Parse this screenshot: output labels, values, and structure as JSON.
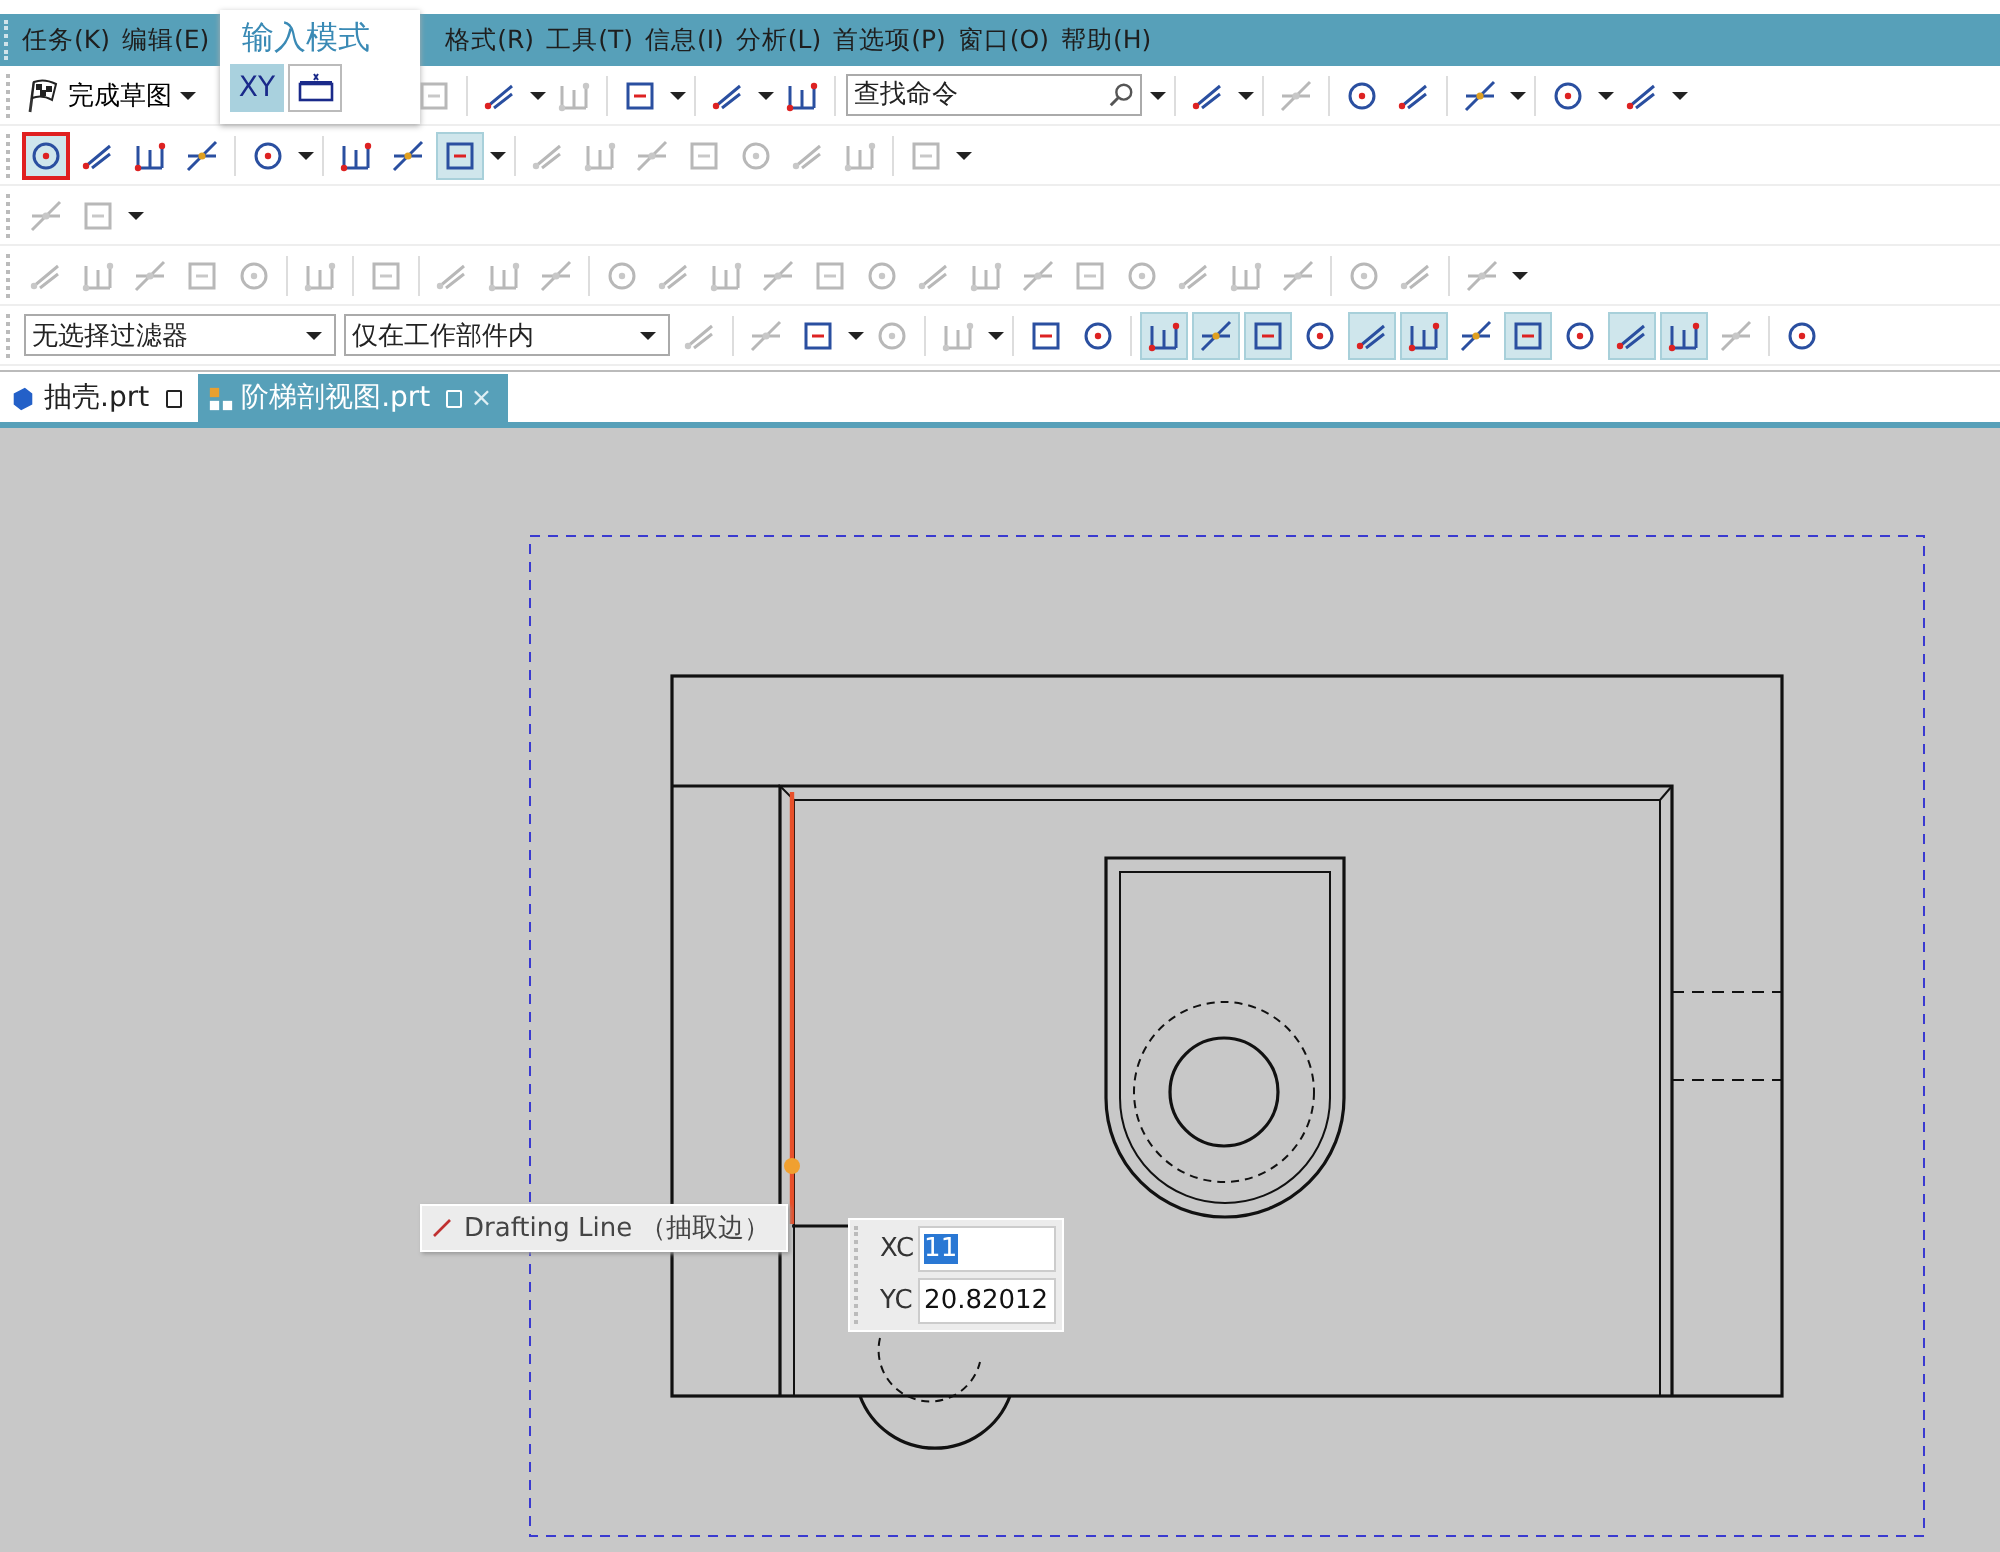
{
  "menu": [
    "任务(K)",
    "编辑(E)",
    "格式(R)",
    "工具(T)",
    "信息(I)",
    "分析(L)",
    "首选项(P)",
    "窗口(O)",
    "帮助(H)"
  ],
  "input_mode_popup": {
    "title": "输入模式",
    "buttons": [
      {
        "label": "XY",
        "selected": true
      },
      {
        "selected": false
      }
    ]
  },
  "toolbars": [
    [
      {
        "kind": "text",
        "label": "完成草图",
        "dropdown": true
      },
      {
        "kind": "sep"
      },
      {
        "kind": "btn",
        "disabled": true
      },
      {
        "kind": "sep"
      },
      {
        "kind": "btn",
        "dropdown": true
      },
      {
        "kind": "btn",
        "disabled": true
      },
      {
        "kind": "sep"
      },
      {
        "kind": "btn",
        "dropdown": true
      },
      {
        "kind": "sep"
      },
      {
        "kind": "btn",
        "dropdown": true
      },
      {
        "kind": "btn"
      },
      {
        "kind": "sep"
      },
      {
        "kind": "search",
        "placeholder": "查找命令"
      },
      {
        "kind": "sep"
      },
      {
        "kind": "btn",
        "dropdown": true
      },
      {
        "kind": "sep"
      },
      {
        "kind": "btn",
        "disabled": true
      },
      {
        "kind": "sep"
      },
      {
        "kind": "btn"
      },
      {
        "kind": "btn"
      },
      {
        "kind": "sep"
      },
      {
        "kind": "btn",
        "dropdown": true
      },
      {
        "kind": "sep"
      },
      {
        "kind": "btn",
        "dropdown": true
      },
      {
        "kind": "btn",
        "dropdown": true
      }
    ],
    [
      {
        "kind": "btn",
        "on": true,
        "marked": true
      },
      {
        "kind": "btn"
      },
      {
        "kind": "btn"
      },
      {
        "kind": "btn"
      },
      {
        "kind": "sep"
      },
      {
        "kind": "btn",
        "dropdown": true
      },
      {
        "kind": "sep"
      },
      {
        "kind": "btn"
      },
      {
        "kind": "btn"
      },
      {
        "kind": "btn",
        "on": true,
        "dropdown": true
      },
      {
        "kind": "sep"
      },
      {
        "kind": "btn",
        "disabled": true
      },
      {
        "kind": "btn",
        "disabled": true
      },
      {
        "kind": "btn",
        "disabled": true
      },
      {
        "kind": "btn",
        "disabled": true
      },
      {
        "kind": "btn",
        "disabled": true
      },
      {
        "kind": "btn",
        "disabled": true
      },
      {
        "kind": "btn",
        "disabled": true
      },
      {
        "kind": "sep"
      },
      {
        "kind": "btn",
        "disabled": true,
        "dropdown": true
      }
    ],
    [
      {
        "kind": "btn",
        "disabled": true
      },
      {
        "kind": "btn",
        "disabled": true,
        "dropdown": true
      }
    ],
    [
      {
        "kind": "btn",
        "disabled": true
      },
      {
        "kind": "btn",
        "disabled": true
      },
      {
        "kind": "btn",
        "disabled": true
      },
      {
        "kind": "btn",
        "disabled": true
      },
      {
        "kind": "btn",
        "disabled": true
      },
      {
        "kind": "sep"
      },
      {
        "kind": "btn",
        "disabled": true
      },
      {
        "kind": "sep"
      },
      {
        "kind": "btn",
        "disabled": true
      },
      {
        "kind": "sep"
      },
      {
        "kind": "btn",
        "disabled": true
      },
      {
        "kind": "btn",
        "disabled": true
      },
      {
        "kind": "btn",
        "disabled": true
      },
      {
        "kind": "sep"
      },
      {
        "kind": "btn",
        "disabled": true
      },
      {
        "kind": "btn",
        "disabled": true
      },
      {
        "kind": "btn",
        "disabled": true
      },
      {
        "kind": "btn",
        "disabled": true
      },
      {
        "kind": "btn",
        "disabled": true
      },
      {
        "kind": "btn",
        "disabled": true
      },
      {
        "kind": "btn",
        "disabled": true
      },
      {
        "kind": "btn",
        "disabled": true
      },
      {
        "kind": "btn",
        "disabled": true
      },
      {
        "kind": "btn",
        "disabled": true
      },
      {
        "kind": "btn",
        "disabled": true
      },
      {
        "kind": "btn",
        "disabled": true
      },
      {
        "kind": "btn",
        "disabled": true
      },
      {
        "kind": "btn",
        "disabled": true
      },
      {
        "kind": "sep"
      },
      {
        "kind": "btn",
        "disabled": true
      },
      {
        "kind": "btn",
        "disabled": true
      },
      {
        "kind": "sep"
      },
      {
        "kind": "btn",
        "disabled": true,
        "dropdown": true
      }
    ],
    [
      {
        "kind": "select",
        "value": "无选择过滤器"
      },
      {
        "kind": "select",
        "value": "仅在工作部件内"
      },
      {
        "kind": "btn",
        "disabled": true
      },
      {
        "kind": "sep"
      },
      {
        "kind": "btn",
        "disabled": true
      },
      {
        "kind": "btn",
        "dropdown": true
      },
      {
        "kind": "btn",
        "disabled": true
      },
      {
        "kind": "sep"
      },
      {
        "kind": "btn",
        "disabled": true,
        "dropdown": true
      },
      {
        "kind": "sep"
      },
      {
        "kind": "btn"
      },
      {
        "kind": "btn"
      },
      {
        "kind": "sep"
      },
      {
        "kind": "btn",
        "on": true
      },
      {
        "kind": "btn",
        "on": true
      },
      {
        "kind": "btn",
        "on": true
      },
      {
        "kind": "btn"
      },
      {
        "kind": "btn",
        "on": true
      },
      {
        "kind": "btn",
        "on": true
      },
      {
        "kind": "btn"
      },
      {
        "kind": "btn",
        "on": true
      },
      {
        "kind": "btn"
      },
      {
        "kind": "btn",
        "on": true
      },
      {
        "kind": "btn",
        "on": true
      },
      {
        "kind": "btn",
        "disabled": true
      },
      {
        "kind": "sep"
      },
      {
        "kind": "btn"
      }
    ]
  ],
  "tabs": [
    {
      "label": "抽壳.prt",
      "selected": false
    },
    {
      "label": "阶梯剖视图.prt",
      "selected": true,
      "close": "×"
    }
  ],
  "tooltip": {
    "text": "Drafting Line （抽取边）"
  },
  "coordinate_input": [
    {
      "label": "XC",
      "value": "11",
      "selected": true
    },
    {
      "label": "YC",
      "value": "20.82012",
      "selected": false
    }
  ]
}
